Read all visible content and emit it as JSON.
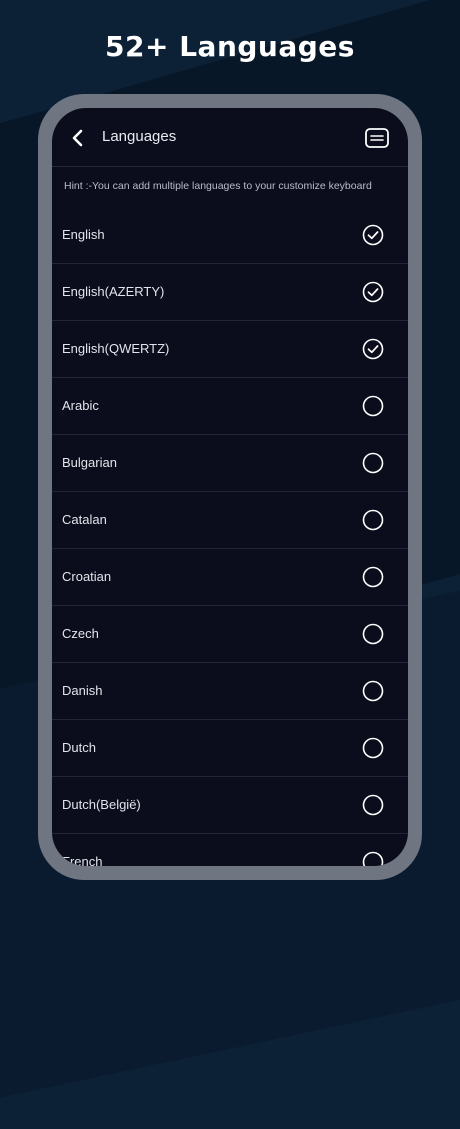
{
  "headline": "52+ Languages",
  "header": {
    "title": "Languages",
    "back_icon": "chevron-left-icon",
    "action_icon": "keyboard-icon"
  },
  "hint": "Hint :-You can add multiple languages to your customize keyboard",
  "languages": [
    {
      "label": "English",
      "selected": true
    },
    {
      "label": "English(AZERTY)",
      "selected": true
    },
    {
      "label": "English(QWERTZ)",
      "selected": true
    },
    {
      "label": "Arabic",
      "selected": false
    },
    {
      "label": "Bulgarian",
      "selected": false
    },
    {
      "label": "Catalan",
      "selected": false
    },
    {
      "label": "Croatian",
      "selected": false
    },
    {
      "label": "Czech",
      "selected": false
    },
    {
      "label": "Danish",
      "selected": false
    },
    {
      "label": "Dutch",
      "selected": false
    },
    {
      "label": "Dutch(België)",
      "selected": false
    },
    {
      "label": "French",
      "selected": false
    }
  ],
  "colors": {
    "background": "#0c2036",
    "frame": "#6f7682",
    "screen": "#0b0d1c",
    "text": "#e2e4ec"
  }
}
